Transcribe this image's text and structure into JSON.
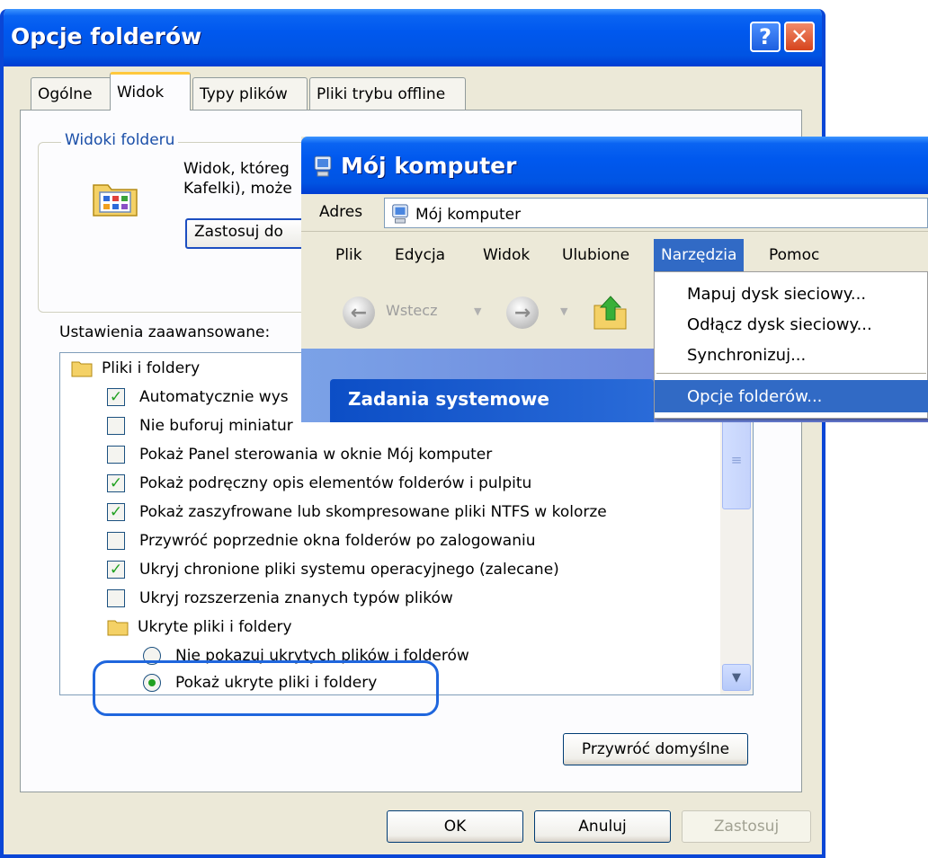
{
  "folder_options": {
    "title": "Opcje folderów",
    "help_glyph": "?",
    "close_glyph": "✕",
    "tabs": [
      "Ogólne",
      "Widok",
      "Typy plików",
      "Pliki trybu offline"
    ],
    "active_tab": "Widok",
    "folder_views": {
      "label": "Widoki folderu",
      "text_line1": "Widok, któreg",
      "text_line2": "Kafelki), może",
      "apply_button": "Zastosuj do"
    },
    "advanced_label": "Ustawienia zaawansowane:",
    "tree": [
      {
        "kind": "folder",
        "label": "Pliki i foldery"
      },
      {
        "kind": "checkbox",
        "checked": true,
        "label": "Automatycznie wys"
      },
      {
        "kind": "checkbox",
        "checked": false,
        "label": "Nie buforuj miniatur"
      },
      {
        "kind": "checkbox",
        "checked": false,
        "label": "Pokaż Panel sterowania w oknie Mój komputer"
      },
      {
        "kind": "checkbox",
        "checked": true,
        "label": "Pokaż podręczny opis elementów folderów i pulpitu"
      },
      {
        "kind": "checkbox",
        "checked": true,
        "label": "Pokaż zaszyfrowane lub skompresowane pliki NTFS w kolorze"
      },
      {
        "kind": "checkbox",
        "checked": false,
        "label": "Przywróć poprzednie okna folderów po zalogowaniu"
      },
      {
        "kind": "checkbox",
        "checked": true,
        "label": "Ukryj chronione pliki systemu operacyjnego (zalecane)"
      },
      {
        "kind": "checkbox",
        "checked": false,
        "label": "Ukryj rozszerzenia znanych typów plików"
      },
      {
        "kind": "folder",
        "label": "Ukryte pliki i foldery"
      },
      {
        "kind": "radio",
        "checked": false,
        "label": "Nie pokazuj ukrytych plików i folderów"
      },
      {
        "kind": "radio",
        "checked": true,
        "label": "Pokaż ukryte pliki i foldery"
      }
    ],
    "restore_defaults": "Przywróć domyślne",
    "ok": "OK",
    "cancel": "Anuluj",
    "apply": "Zastosuj"
  },
  "my_computer": {
    "title": "Mój komputer",
    "address_label": "Adres",
    "address_value": "Mój komputer",
    "menu": [
      "Plik",
      "Edycja",
      "Widok",
      "Ulubione",
      "Narzędzia",
      "Pomoc"
    ],
    "open_menu": "Narzędzia",
    "back_label": "Wstecz",
    "tasks_title": "Zadania systemowe",
    "tools_menu": [
      "Mapuj dysk sieciowy...",
      "Odłącz dysk sieciowy...",
      "Synchronizuj...",
      "Opcje folderów..."
    ],
    "selected_menu_item": "Opcje folderów..."
  },
  "colors": {
    "titlebar": "#0054e3",
    "highlight": "#316ac5",
    "annotation_oval": "#1f66dd",
    "check_green": "#21a121"
  }
}
